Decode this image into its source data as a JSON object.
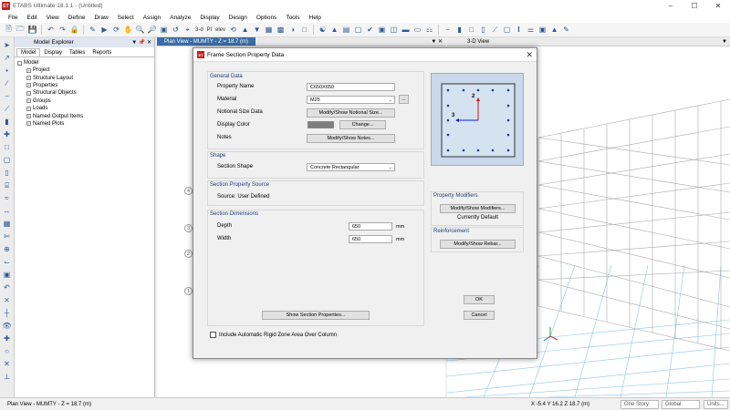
{
  "app": {
    "title": "ETABS Ultimate 18.1.1 - (Untitled)",
    "logo": "ET"
  },
  "menu": [
    "File",
    "Edit",
    "View",
    "Define",
    "Draw",
    "Select",
    "Assign",
    "Analyze",
    "Display",
    "Design",
    "Options",
    "Tools",
    "Help"
  ],
  "toolbar": {
    "three_d": "3-d",
    "pl": "Pl",
    "elev": "elev"
  },
  "explorer": {
    "title": "Model Explorer",
    "tabs": [
      "Model",
      "Display",
      "Tables",
      "Reports"
    ],
    "root": "Model",
    "items": [
      "Project",
      "Structure Layout",
      "Properties",
      "Structural Objects",
      "Groups",
      "Loads",
      "Named Output Items",
      "Named Plots"
    ]
  },
  "views": {
    "plan_tab": "Plan View - MUMTY - Z = 18.7 (m)",
    "three_d_tab": "3-D View",
    "grid_bubbles": [
      "4",
      "3",
      "2",
      "1"
    ]
  },
  "status": {
    "left": "Plan View - MUMTY - Z = 18.7 (m)",
    "coords": "X -5.4  Y 16.2  Z 18.7 (m)",
    "story": "One Story",
    "system": "Global",
    "units": "Units..."
  },
  "dialog": {
    "title": "Frame Section Property Data",
    "logo": "ET",
    "general": {
      "heading": "General Data",
      "property_name_label": "Property Name",
      "property_name_value": "C650X650",
      "material_label": "Material",
      "material_value": "M25",
      "ellipsis": "...",
      "notional_label": "Notional Size Data",
      "notional_button": "Modify/Show Notional Size...",
      "color_label": "Display Color",
      "color_button": "Change...",
      "notes_label": "Notes",
      "notes_button": "Modify/Show Notes...",
      "display_color": "#7f7f7f"
    },
    "shape": {
      "heading": "Shape",
      "label": "Section Shape",
      "value": "Concrete Rectangular"
    },
    "source": {
      "heading": "Section Property Source",
      "text": "Source:  User Defined"
    },
    "dimensions": {
      "heading": "Section Dimensions",
      "depth_label": "Depth",
      "depth_value": "650",
      "width_label": "Width",
      "width_value": "650",
      "unit": "mm"
    },
    "preview": {
      "axis2": "2",
      "axis3": "3"
    },
    "modifiers": {
      "heading": "Property Modifiers",
      "button": "Modify/Show Modifiers...",
      "status": "Currently Default"
    },
    "reinforcement": {
      "heading": "Reinforcement",
      "button": "Modify/Show Rebar..."
    },
    "ok": "OK",
    "cancel": "Cancel",
    "show_props": "Show Section Properties...",
    "rigid_zone_label": "Include Automatic Rigid Zone Area Over Column"
  }
}
